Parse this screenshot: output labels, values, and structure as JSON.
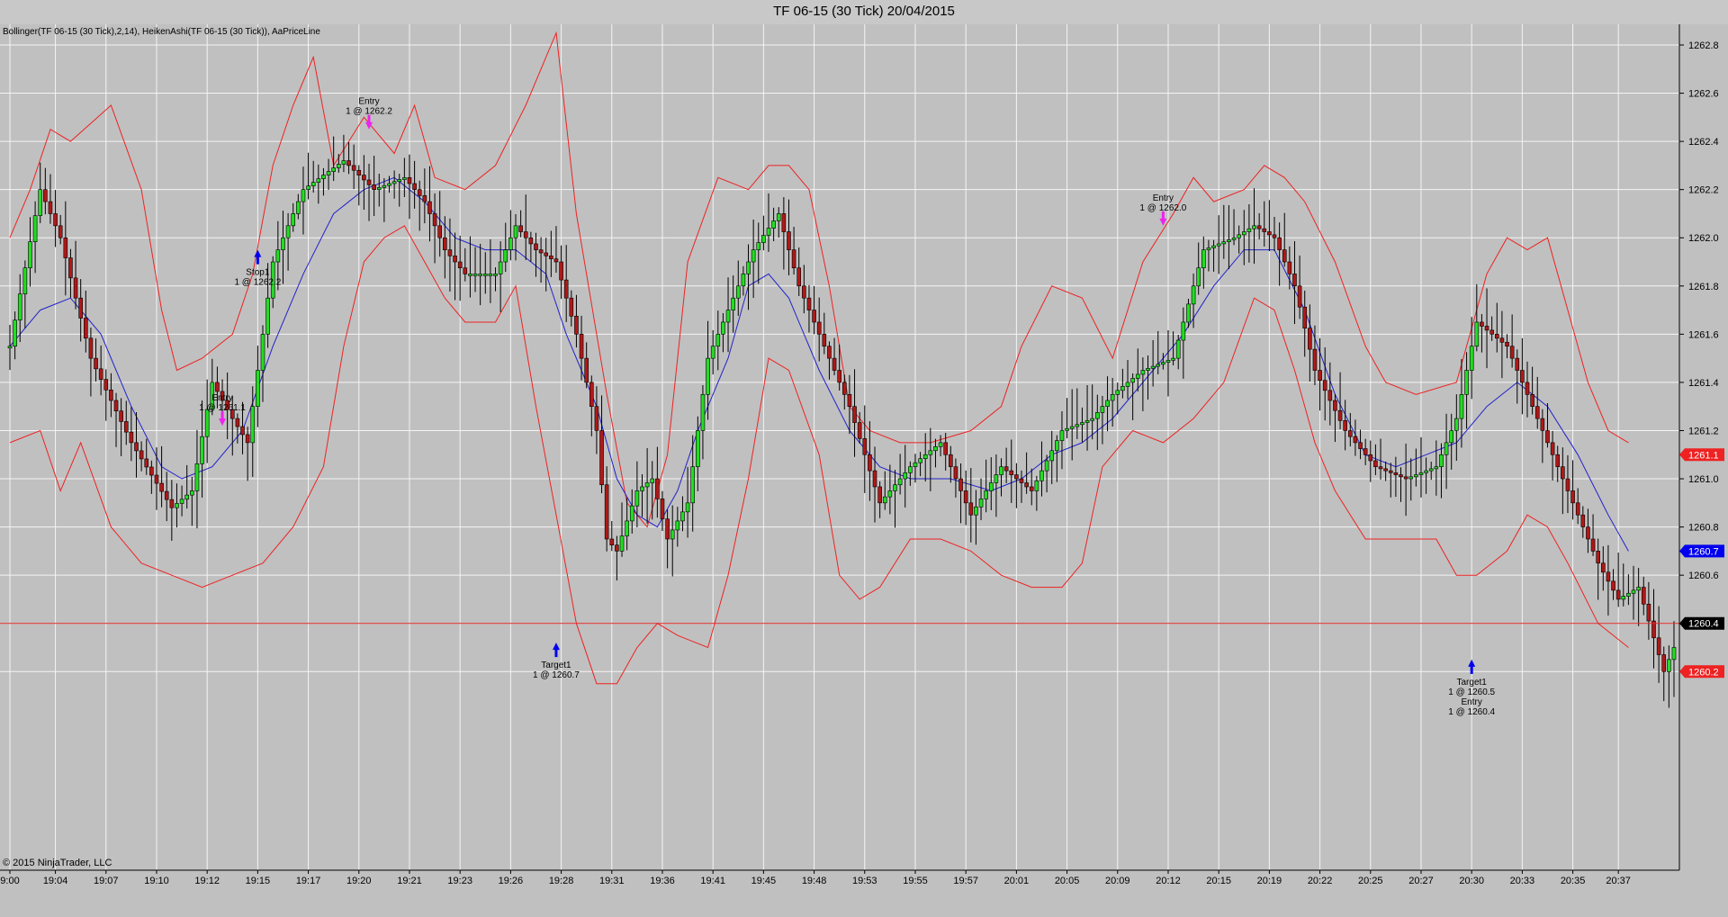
{
  "window": {
    "title": "TF 06-15 (30 Tick)  20/04/2015"
  },
  "indicator_label": "Bollinger(TF 06-15 (30 Tick),2,14), HeikenAshi(TF 06-15 (30 Tick)), AaPriceLine",
  "copyright": "© 2015 NinjaTrader, LLC",
  "colors": {
    "background": "#c0c0c0",
    "grid": "#f4f4f4",
    "bull": "#22dd22",
    "bear": "#b01818",
    "bollinger": "#ee2222",
    "midline": "#2222cc",
    "priceline": "#dd2222",
    "entry_marker": "#ee22ee",
    "target_marker": "#0000ee"
  },
  "chart_data": {
    "type": "candlestick",
    "instrument": "TF 06-15 (30 Tick)",
    "date": "20/04/2015",
    "ylim": [
      1260.0,
      1262.9
    ],
    "y_ticks": [
      1262.8,
      1262.6,
      1262.4,
      1262.2,
      1262.0,
      1261.8,
      1261.6,
      1261.4,
      1261.2,
      1261.0,
      1260.8,
      1260.6,
      1260.4,
      1260.2
    ],
    "y_tick_labels": [
      "1262.8",
      "1262.6",
      "1262.4",
      "1262.2",
      "1262.0",
      "1261.8",
      "1261.6",
      "1261.4",
      "1261.2",
      "1261.0",
      "1260.8",
      "1260.6",
      "1260.4",
      "1260.2"
    ],
    "x_ticks": [
      "9:00",
      "19:04",
      "19:07",
      "19:10",
      "19:12",
      "19:15",
      "19:17",
      "19:20",
      "19:21",
      "19:23",
      "19:26",
      "19:28",
      "19:31",
      "19:36",
      "19:41",
      "19:45",
      "19:48",
      "19:53",
      "19:55",
      "19:57",
      "20:01",
      "20:05",
      "20:09",
      "20:12",
      "20:15",
      "20:19",
      "20:22",
      "20:25",
      "20:27",
      "20:30",
      "20:33",
      "20:35",
      "20:37"
    ],
    "x_tick_bars": [
      0,
      9,
      19,
      29,
      39,
      49,
      59,
      69,
      79,
      89,
      99,
      109,
      119,
      129,
      139,
      149,
      159,
      169,
      179,
      189,
      199,
      209,
      219,
      229,
      239,
      249,
      259,
      269,
      279,
      289,
      299,
      309,
      318
    ],
    "price_line": {
      "value": 1260.4,
      "label": "1260.4"
    },
    "axis_markers": [
      {
        "value": 1261.1,
        "label": "1261.1",
        "color": "#ee2222"
      },
      {
        "value": 1260.7,
        "label": "1260.7",
        "color": "#0000ee"
      },
      {
        "value": 1260.4,
        "label": "1260.4",
        "color": "#000000"
      },
      {
        "value": 1260.2,
        "label": "1260.2",
        "color": "#ee2222"
      }
    ],
    "bars_count": 330,
    "close_path": [
      [
        0,
        1261.55
      ],
      [
        6,
        1262.2
      ],
      [
        10,
        1262.0
      ],
      [
        16,
        1261.5
      ],
      [
        24,
        1261.15
      ],
      [
        32,
        1260.88
      ],
      [
        36,
        1260.95
      ],
      [
        40,
        1261.4
      ],
      [
        44,
        1261.25
      ],
      [
        47,
        1261.15
      ],
      [
        52,
        1261.9
      ],
      [
        58,
        1262.2
      ],
      [
        66,
        1262.32
      ],
      [
        72,
        1262.2
      ],
      [
        78,
        1262.25
      ],
      [
        82,
        1262.15
      ],
      [
        86,
        1261.95
      ],
      [
        90,
        1261.85
      ],
      [
        96,
        1261.85
      ],
      [
        100,
        1262.05
      ],
      [
        104,
        1261.95
      ],
      [
        108,
        1261.9
      ],
      [
        112,
        1261.6
      ],
      [
        116,
        1261.2
      ],
      [
        118,
        1260.75
      ],
      [
        120,
        1260.7
      ],
      [
        124,
        1260.95
      ],
      [
        127,
        1261.0
      ],
      [
        130,
        1260.75
      ],
      [
        134,
        1260.9
      ],
      [
        138,
        1261.5
      ],
      [
        142,
        1261.7
      ],
      [
        147,
        1261.95
      ],
      [
        152,
        1262.1
      ],
      [
        156,
        1261.8
      ],
      [
        160,
        1261.6
      ],
      [
        166,
        1261.3
      ],
      [
        172,
        1260.9
      ],
      [
        178,
        1261.05
      ],
      [
        184,
        1261.15
      ],
      [
        190,
        1260.85
      ],
      [
        196,
        1261.05
      ],
      [
        202,
        1260.95
      ],
      [
        208,
        1261.2
      ],
      [
        214,
        1261.25
      ],
      [
        218,
        1261.35
      ],
      [
        224,
        1261.45
      ],
      [
        230,
        1261.5
      ],
      [
        236,
        1261.95
      ],
      [
        242,
        1262.0
      ],
      [
        246,
        1262.05
      ],
      [
        250,
        1262.0
      ],
      [
        254,
        1261.8
      ],
      [
        258,
        1261.45
      ],
      [
        264,
        1261.2
      ],
      [
        270,
        1261.05
      ],
      [
        276,
        1261.0
      ],
      [
        282,
        1261.05
      ],
      [
        286,
        1261.25
      ],
      [
        290,
        1261.65
      ],
      [
        296,
        1261.55
      ],
      [
        302,
        1261.25
      ],
      [
        308,
        1260.95
      ],
      [
        314,
        1260.65
      ],
      [
        318,
        1260.5
      ],
      [
        322,
        1260.55
      ],
      [
        327,
        1260.2
      ],
      [
        329,
        1260.3
      ]
    ],
    "bollinger_upper": [
      [
        0,
        1262.0
      ],
      [
        4,
        1262.2
      ],
      [
        8,
        1262.45
      ],
      [
        12,
        1262.4
      ],
      [
        20,
        1262.55
      ],
      [
        26,
        1262.2
      ],
      [
        30,
        1261.7
      ],
      [
        33,
        1261.45
      ],
      [
        38,
        1261.5
      ],
      [
        44,
        1261.6
      ],
      [
        48,
        1261.85
      ],
      [
        52,
        1262.3
      ],
      [
        56,
        1262.55
      ],
      [
        60,
        1262.75
      ],
      [
        64,
        1262.3
      ],
      [
        70,
        1262.5
      ],
      [
        76,
        1262.35
      ],
      [
        80,
        1262.55
      ],
      [
        84,
        1262.25
      ],
      [
        90,
        1262.2
      ],
      [
        96,
        1262.3
      ],
      [
        102,
        1262.55
      ],
      [
        108,
        1262.85
      ],
      [
        112,
        1262.1
      ],
      [
        118,
        1261.35
      ],
      [
        122,
        1260.9
      ],
      [
        126,
        1260.8
      ],
      [
        130,
        1261.1
      ],
      [
        134,
        1261.9
      ],
      [
        140,
        1262.25
      ],
      [
        146,
        1262.2
      ],
      [
        150,
        1262.3
      ],
      [
        154,
        1262.3
      ],
      [
        158,
        1262.2
      ],
      [
        162,
        1261.8
      ],
      [
        166,
        1261.3
      ],
      [
        170,
        1261.2
      ],
      [
        176,
        1261.15
      ],
      [
        182,
        1261.15
      ],
      [
        190,
        1261.2
      ],
      [
        196,
        1261.3
      ],
      [
        200,
        1261.55
      ],
      [
        206,
        1261.8
      ],
      [
        212,
        1261.75
      ],
      [
        218,
        1261.5
      ],
      [
        224,
        1261.9
      ],
      [
        230,
        1262.1
      ],
      [
        234,
        1262.25
      ],
      [
        238,
        1262.15
      ],
      [
        244,
        1262.2
      ],
      [
        248,
        1262.3
      ],
      [
        252,
        1262.25
      ],
      [
        256,
        1262.15
      ],
      [
        262,
        1261.9
      ],
      [
        268,
        1261.55
      ],
      [
        272,
        1261.4
      ],
      [
        278,
        1261.35
      ],
      [
        286,
        1261.4
      ],
      [
        292,
        1261.85
      ],
      [
        296,
        1262.0
      ],
      [
        300,
        1261.95
      ],
      [
        304,
        1262.0
      ],
      [
        308,
        1261.7
      ],
      [
        312,
        1261.4
      ],
      [
        316,
        1261.2
      ],
      [
        320,
        1261.15
      ]
    ],
    "bollinger_lower": [
      [
        0,
        1261.15
      ],
      [
        6,
        1261.2
      ],
      [
        10,
        1260.95
      ],
      [
        14,
        1261.15
      ],
      [
        20,
        1260.8
      ],
      [
        26,
        1260.65
      ],
      [
        32,
        1260.6
      ],
      [
        38,
        1260.55
      ],
      [
        44,
        1260.6
      ],
      [
        50,
        1260.65
      ],
      [
        56,
        1260.8
      ],
      [
        62,
        1261.05
      ],
      [
        66,
        1261.55
      ],
      [
        70,
        1261.9
      ],
      [
        74,
        1262.0
      ],
      [
        78,
        1262.05
      ],
      [
        82,
        1261.9
      ],
      [
        86,
        1261.75
      ],
      [
        90,
        1261.65
      ],
      [
        96,
        1261.65
      ],
      [
        100,
        1261.8
      ],
      [
        104,
        1261.3
      ],
      [
        108,
        1260.85
      ],
      [
        112,
        1260.4
      ],
      [
        116,
        1260.15
      ],
      [
        120,
        1260.15
      ],
      [
        124,
        1260.3
      ],
      [
        128,
        1260.4
      ],
      [
        132,
        1260.35
      ],
      [
        138,
        1260.3
      ],
      [
        142,
        1260.6
      ],
      [
        146,
        1261.0
      ],
      [
        150,
        1261.5
      ],
      [
        154,
        1261.45
      ],
      [
        160,
        1261.1
      ],
      [
        164,
        1260.6
      ],
      [
        168,
        1260.5
      ],
      [
        172,
        1260.55
      ],
      [
        178,
        1260.75
      ],
      [
        184,
        1260.75
      ],
      [
        190,
        1260.7
      ],
      [
        196,
        1260.6
      ],
      [
        202,
        1260.55
      ],
      [
        208,
        1260.55
      ],
      [
        212,
        1260.65
      ],
      [
        216,
        1261.05
      ],
      [
        222,
        1261.2
      ],
      [
        228,
        1261.15
      ],
      [
        234,
        1261.25
      ],
      [
        240,
        1261.4
      ],
      [
        246,
        1261.75
      ],
      [
        250,
        1261.7
      ],
      [
        254,
        1261.45
      ],
      [
        258,
        1261.15
      ],
      [
        262,
        1260.95
      ],
      [
        268,
        1260.75
      ],
      [
        276,
        1260.75
      ],
      [
        282,
        1260.75
      ],
      [
        286,
        1260.6
      ],
      [
        290,
        1260.6
      ],
      [
        296,
        1260.7
      ],
      [
        300,
        1260.85
      ],
      [
        304,
        1260.8
      ],
      [
        308,
        1260.65
      ],
      [
        314,
        1260.4
      ],
      [
        320,
        1260.3
      ]
    ],
    "bollinger_mid": [
      [
        0,
        1261.55
      ],
      [
        6,
        1261.7
      ],
      [
        12,
        1261.75
      ],
      [
        18,
        1261.6
      ],
      [
        24,
        1261.3
      ],
      [
        30,
        1261.05
      ],
      [
        34,
        1261.0
      ],
      [
        40,
        1261.05
      ],
      [
        46,
        1261.2
      ],
      [
        52,
        1261.55
      ],
      [
        58,
        1261.85
      ],
      [
        64,
        1262.1
      ],
      [
        70,
        1262.2
      ],
      [
        76,
        1262.25
      ],
      [
        82,
        1262.15
      ],
      [
        88,
        1262.0
      ],
      [
        94,
        1261.95
      ],
      [
        100,
        1261.95
      ],
      [
        106,
        1261.85
      ],
      [
        110,
        1261.6
      ],
      [
        116,
        1261.3
      ],
      [
        120,
        1261.0
      ],
      [
        124,
        1260.85
      ],
      [
        128,
        1260.8
      ],
      [
        132,
        1260.95
      ],
      [
        136,
        1261.2
      ],
      [
        142,
        1261.5
      ],
      [
        146,
        1261.8
      ],
      [
        150,
        1261.85
      ],
      [
        154,
        1261.75
      ],
      [
        160,
        1261.45
      ],
      [
        166,
        1261.2
      ],
      [
        172,
        1261.05
      ],
      [
        178,
        1261.0
      ],
      [
        186,
        1261.0
      ],
      [
        194,
        1260.95
      ],
      [
        200,
        1261.0
      ],
      [
        206,
        1261.1
      ],
      [
        212,
        1261.15
      ],
      [
        218,
        1261.25
      ],
      [
        226,
        1261.45
      ],
      [
        232,
        1261.6
      ],
      [
        238,
        1261.8
      ],
      [
        244,
        1261.95
      ],
      [
        250,
        1261.95
      ],
      [
        256,
        1261.7
      ],
      [
        262,
        1261.35
      ],
      [
        268,
        1261.1
      ],
      [
        274,
        1261.05
      ],
      [
        280,
        1261.1
      ],
      [
        286,
        1261.15
      ],
      [
        292,
        1261.3
      ],
      [
        298,
        1261.4
      ],
      [
        304,
        1261.3
      ],
      [
        310,
        1261.1
      ],
      [
        316,
        1260.85
      ],
      [
        320,
        1260.7
      ]
    ],
    "trade_markers": [
      {
        "bar": 42,
        "price": 1261.22,
        "kind": "entry",
        "dir": "down",
        "label1": "Entry",
        "label2": "1 @ 1261.1"
      },
      {
        "bar": 49,
        "price": 1261.95,
        "kind": "stop",
        "dir": "up",
        "label1": "Stop1",
        "label2": "1 @ 1262.2"
      },
      {
        "bar": 71,
        "price": 1262.45,
        "kind": "entry",
        "dir": "down",
        "label1": "Entry",
        "label2": "1 @ 1262.2"
      },
      {
        "bar": 108,
        "price": 1260.32,
        "kind": "target",
        "dir": "up",
        "label1": "Target1",
        "label2": "1 @ 1260.7"
      },
      {
        "bar": 228,
        "price": 1262.05,
        "kind": "entry",
        "dir": "down",
        "label1": "Entry",
        "label2": "1 @ 1262.0"
      },
      {
        "bar": 289,
        "price": 1260.25,
        "kind": "target",
        "dir": "up",
        "label1": "Target1",
        "label2": "1 @ 1260.5",
        "label3": "Entry",
        "label4": "1 @ 1260.4"
      }
    ]
  }
}
